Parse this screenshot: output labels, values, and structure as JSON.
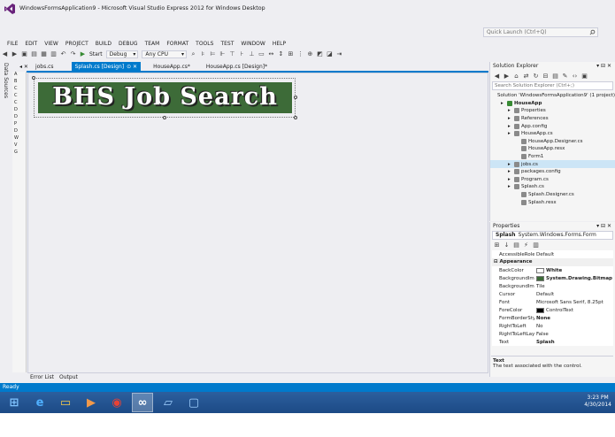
{
  "window": {
    "title": "WindowsFormsApplication9 - Microsoft Visual Studio Express 2012 for Windows Desktop",
    "quick_launch_placeholder": "Quick Launch (Ctrl+Q)"
  },
  "menu": [
    "FILE",
    "EDIT",
    "VIEW",
    "PROJECT",
    "BUILD",
    "DEBUG",
    "TEAM",
    "FORMAT",
    "TOOLS",
    "TEST",
    "WINDOW",
    "HELP"
  ],
  "toolbar": {
    "start_label": "Start",
    "config": "Debug",
    "platform": "Any CPU"
  },
  "left_strip": {
    "label": "Data Sources"
  },
  "toolbox_letters": [
    "A",
    "B",
    "C",
    "C",
    "C",
    "D",
    "D",
    "P",
    "D",
    "W",
    "V",
    "G"
  ],
  "doc_tabs": [
    {
      "label": "jobs.cs",
      "active": false
    },
    {
      "label": "Splash.cs [Design]",
      "active": true
    },
    {
      "label": "HouseApp.cs*",
      "active": false
    },
    {
      "label": "HouseApp.cs [Design]*",
      "active": false
    }
  ],
  "designer": {
    "banner_text": "BHS Job Search"
  },
  "bottom_tabs": [
    "Error List",
    "Output"
  ],
  "solution_explorer": {
    "title": "Solution Explorer",
    "search_placeholder": "Search Solution Explorer (Ctrl+;)",
    "items": [
      {
        "label": "Solution 'WindowsFormsApplication9' (1 project)",
        "indent": 0,
        "bold": false,
        "selected": false
      },
      {
        "label": "HouseApp",
        "indent": 1,
        "bold": true,
        "selected": false
      },
      {
        "label": "Properties",
        "indent": 2,
        "bold": false,
        "selected": false
      },
      {
        "label": "References",
        "indent": 2,
        "bold": false,
        "selected": false
      },
      {
        "label": "App.config",
        "indent": 2,
        "bold": false,
        "selected": false
      },
      {
        "label": "HouseApp.cs",
        "indent": 2,
        "bold": false,
        "selected": false
      },
      {
        "label": "HouseApp.Designer.cs",
        "indent": 3,
        "bold": false,
        "selected": false
      },
      {
        "label": "HouseApp.resx",
        "indent": 3,
        "bold": false,
        "selected": false
      },
      {
        "label": "Form1",
        "indent": 3,
        "bold": false,
        "selected": false
      },
      {
        "label": "jobs.cs",
        "indent": 2,
        "bold": false,
        "selected": true
      },
      {
        "label": "packages.config",
        "indent": 2,
        "bold": false,
        "selected": false
      },
      {
        "label": "Program.cs",
        "indent": 2,
        "bold": false,
        "selected": false
      },
      {
        "label": "Splash.cs",
        "indent": 2,
        "bold": false,
        "selected": false
      },
      {
        "label": "Splash.Designer.cs",
        "indent": 3,
        "bold": false,
        "selected": false
      },
      {
        "label": "Splash.resx",
        "indent": 3,
        "bold": false,
        "selected": false
      }
    ]
  },
  "properties": {
    "title": "Properties",
    "object_name": "Splash",
    "object_type": "System.Windows.Forms.Form",
    "rows": [
      {
        "kind": "prop",
        "name": "AccessibleRole",
        "value": "Default",
        "bold": false,
        "swatch": ""
      },
      {
        "kind": "cat",
        "name": "Appearance"
      },
      {
        "kind": "prop",
        "name": "BackColor",
        "value": "White",
        "bold": true,
        "swatch": "#ffffff"
      },
      {
        "kind": "prop",
        "name": "BackgroundImage",
        "value": "System.Drawing.Bitmap",
        "bold": true,
        "swatch": "#3d6b38"
      },
      {
        "kind": "prop",
        "name": "BackgroundImageLayout",
        "value": "Tile",
        "bold": false,
        "swatch": ""
      },
      {
        "kind": "prop",
        "name": "Cursor",
        "value": "Default",
        "bold": false,
        "swatch": ""
      },
      {
        "kind": "prop",
        "name": "Font",
        "value": "Microsoft Sans Serif, 8.25pt",
        "bold": false,
        "swatch": ""
      },
      {
        "kind": "prop",
        "name": "ForeColor",
        "value": "ControlText",
        "bold": false,
        "swatch": "#000000"
      },
      {
        "kind": "prop",
        "name": "FormBorderStyle",
        "value": "None",
        "bold": true,
        "swatch": ""
      },
      {
        "kind": "prop",
        "name": "RightToLeft",
        "value": "No",
        "bold": false,
        "swatch": ""
      },
      {
        "kind": "prop",
        "name": "RightToLeftLayout",
        "value": "False",
        "bold": false,
        "swatch": ""
      },
      {
        "kind": "prop",
        "name": "Text",
        "value": "Splash",
        "bold": true,
        "swatch": ""
      }
    ],
    "desc_title": "Text",
    "desc_body": "The text associated with the control."
  },
  "status": {
    "text": "Ready"
  },
  "taskbar": {
    "apps": [
      "windows-start-icon",
      "internet-explorer-icon",
      "file-explorer-icon",
      "media-player-icon",
      "chrome-icon",
      "visual-studio-icon",
      "app-icon",
      "window-icon"
    ],
    "time": "3:23 PM",
    "date": "4/30/2014"
  },
  "colors": {
    "accent": "#007acc",
    "banner_green": "#3d6b38",
    "taskbar": "#1c4a86"
  }
}
